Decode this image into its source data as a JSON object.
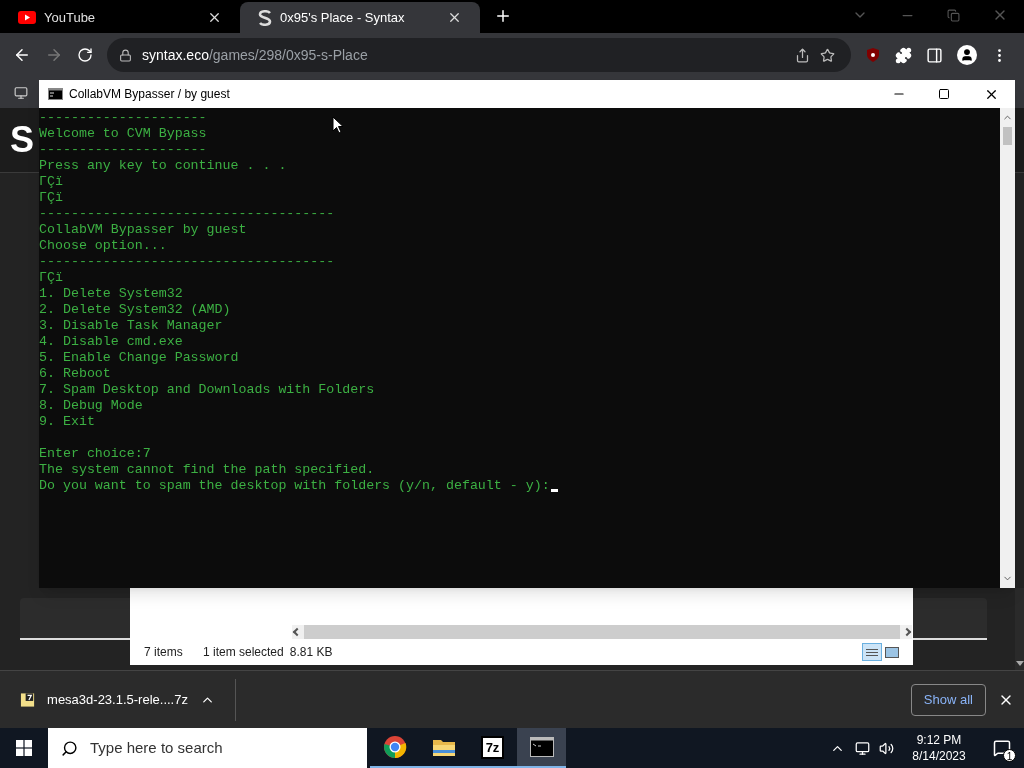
{
  "browser": {
    "tabs": [
      {
        "title": "YouTube",
        "kind": "youtube",
        "selected": false
      },
      {
        "title": "0x95's Place - Syntax",
        "kind": "syntax",
        "selected": true
      }
    ],
    "toolbar": {
      "forward_disabled": true,
      "url_host": "syntax.eco",
      "url_path": "/games/298/0x95-s-Place"
    }
  },
  "page": {
    "logo_text": "S"
  },
  "explorer": {
    "status_items": "7 items",
    "status_selected": "1 item selected",
    "status_size": "8.81 KB"
  },
  "console": {
    "title": "CollabVM Bypasser / by guest",
    "lines": [
      {
        "kind": "text",
        "text": "---------------------"
      },
      {
        "kind": "text",
        "text": "Welcome to CVM Bypass"
      },
      {
        "kind": "text",
        "text": "---------------------"
      },
      {
        "kind": "text",
        "text": "Press any key to continue . . ."
      },
      {
        "kind": "text",
        "text": "ΓÇï"
      },
      {
        "kind": "text",
        "text": "ΓÇï"
      },
      {
        "kind": "text",
        "text": "-------------------------------------"
      },
      {
        "kind": "text",
        "text": "CollabVM Bypasser by guest"
      },
      {
        "kind": "text",
        "text": "Choose option..."
      },
      {
        "kind": "text",
        "text": "-------------------------------------"
      },
      {
        "kind": "text",
        "text": "ΓÇï"
      },
      {
        "kind": "text",
        "text": "1. Delete System32"
      },
      {
        "kind": "text",
        "text": "2. Delete System32 (AMD)"
      },
      {
        "kind": "text",
        "text": "3. Disable Task Manager"
      },
      {
        "kind": "text",
        "text": "4. Disable cmd.exe"
      },
      {
        "kind": "text",
        "text": "5. Enable Change Password"
      },
      {
        "kind": "text",
        "text": "6. Reboot"
      },
      {
        "kind": "text",
        "text": "7. Spam Desktop and Downloads with Folders"
      },
      {
        "kind": "text",
        "text": "8. Debug Mode"
      },
      {
        "kind": "text",
        "text": "9. Exit"
      },
      {
        "kind": "blank"
      },
      {
        "kind": "text",
        "text": "Enter choice:7"
      },
      {
        "kind": "text",
        "text": "The system cannot find the path specified."
      },
      {
        "kind": "prompt",
        "text": "Do you want to spam the desktop with folders (y/n, default - y):"
      }
    ]
  },
  "download_bar": {
    "file": "mesa3d-23.1.5-rele....7z",
    "show_all": "Show all"
  },
  "taskbar": {
    "search_placeholder": "Type here to search",
    "apps": [
      {
        "kind": "chrome",
        "running": true,
        "selected": false
      },
      {
        "kind": "folder",
        "running": true,
        "selected": false
      },
      {
        "kind": "archiver",
        "label": "7z",
        "running": true,
        "selected": false
      },
      {
        "kind": "console",
        "running": true,
        "selected": true
      }
    ],
    "time": "9:12 PM",
    "date": "8/14/2023",
    "notifications": "1"
  }
}
